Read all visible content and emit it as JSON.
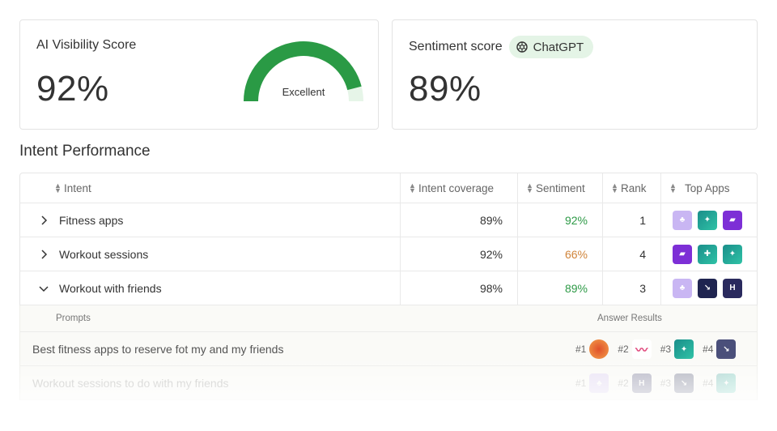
{
  "visibility": {
    "title": "AI Visibility Score",
    "value": "92%",
    "gauge_label": "Excellent",
    "gauge_fraction": 0.92,
    "color": "#2a9a45"
  },
  "sentiment": {
    "title": "Sentiment score",
    "value": "89%",
    "badge": "ChatGPT"
  },
  "section_title": "Intent Performance",
  "table": {
    "headers": [
      "Intent",
      "Intent coverage",
      "Sentiment",
      "Rank",
      "Top Apps"
    ],
    "rows": [
      {
        "intent": "Fitness apps",
        "coverage": "89%",
        "sentiment": "92%",
        "rank": "1",
        "expanded": false
      },
      {
        "intent": "Workout sessions",
        "coverage": "92%",
        "sentiment": "66%",
        "rank": "4",
        "expanded": false
      },
      {
        "intent": "Workout with friends",
        "coverage": "98%",
        "sentiment": "89%",
        "rank": "3",
        "expanded": true
      }
    ]
  },
  "prompts": {
    "label": "Prompts",
    "answer_label": "Answer  Results",
    "rows": [
      {
        "text": "Best fitness apps to reserve fot my and my friends",
        "ranks": [
          "#1",
          "#2",
          "#3",
          "#4"
        ]
      },
      {
        "text": "Workout sessions to do with my friends",
        "ranks": [
          "#1",
          "#2",
          "#3",
          "#4"
        ]
      }
    ]
  },
  "colors": {
    "positive": "#2e9a47",
    "neutral": "#d0843a",
    "badge_bg": "#e4f4e6"
  }
}
